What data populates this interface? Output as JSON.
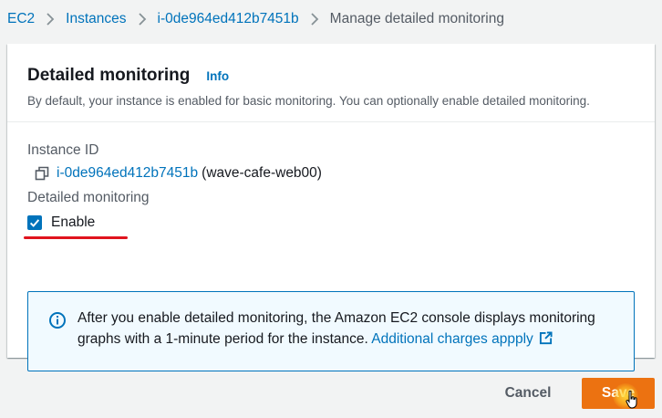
{
  "breadcrumb": {
    "items": [
      "EC2",
      "Instances",
      "i-0de964ed412b7451b"
    ],
    "current": "Manage detailed monitoring"
  },
  "panel": {
    "title": "Detailed monitoring",
    "info_label": "Info",
    "description": "By default, your instance is enabled for basic monitoring. You can optionally enable detailed monitoring."
  },
  "fields": {
    "instance_id_label": "Instance ID",
    "instance_id": "i-0de964ed412b7451b",
    "instance_name": "(wave-cafe-web00)",
    "detailed_monitoring_label": "Detailed monitoring",
    "enable_label": "Enable",
    "enable_checked": true
  },
  "alert": {
    "text": "After you enable detailed monitoring, the Amazon EC2 console displays monitoring graphs with a 1-minute period for the instance.",
    "link_text": "Additional charges appply"
  },
  "footer": {
    "cancel_label": "Cancel",
    "save_label": "Save"
  },
  "colors": {
    "link": "#0073bb",
    "primary_button": "#ec7211",
    "alert_background": "#f1faff",
    "annotation_underline": "#e0141e"
  },
  "icons": [
    "chevron-right-icon",
    "copy-icon",
    "checkmark-icon",
    "info-circle-icon",
    "external-link-icon",
    "pointer-cursor-icon"
  ]
}
